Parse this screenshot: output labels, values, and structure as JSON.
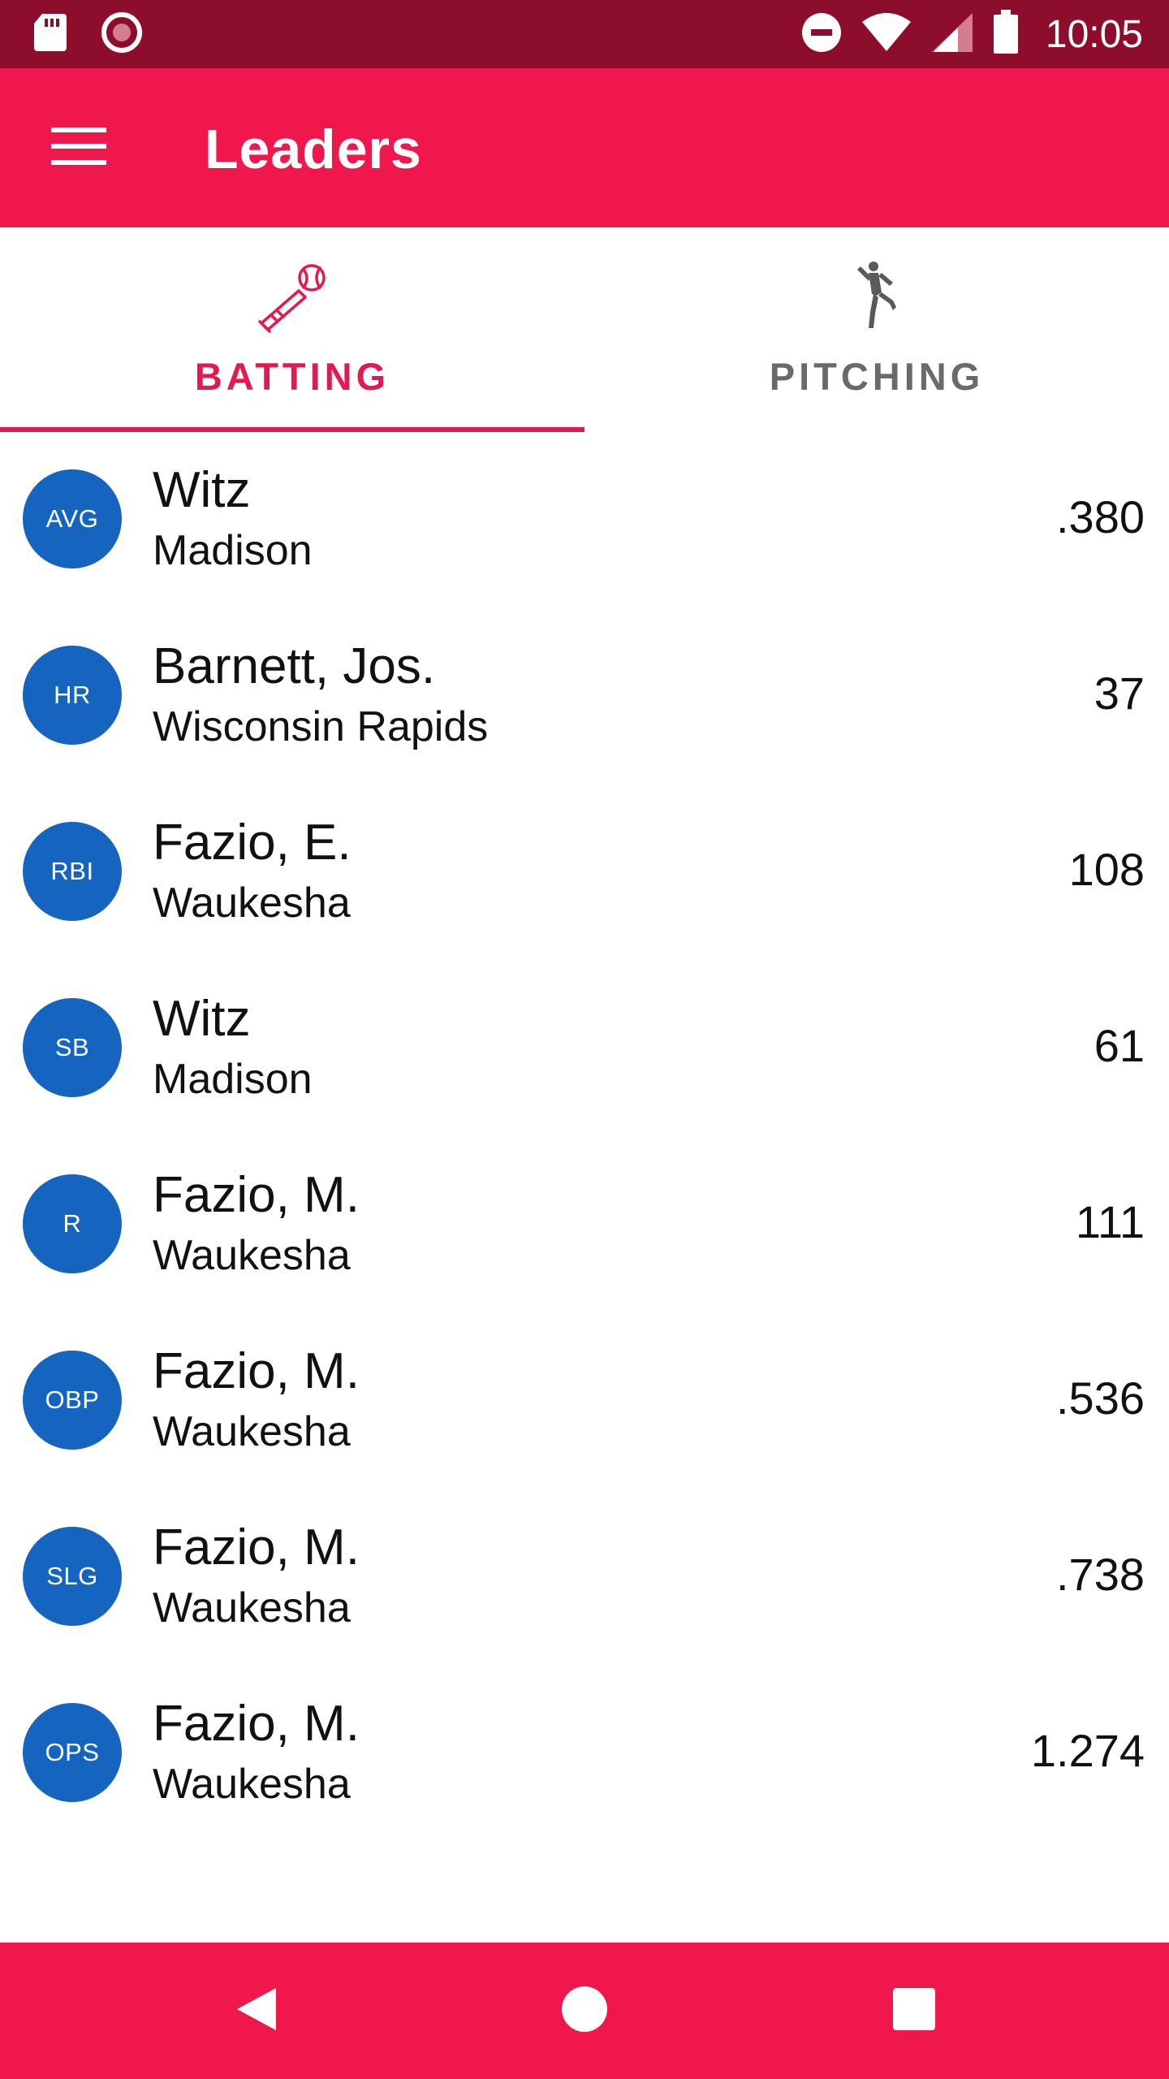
{
  "status_bar": {
    "time": "10:05",
    "icons": [
      "sd-card-icon",
      "record-icon",
      "do-not-disturb-icon",
      "wifi-icon",
      "cell-signal-icon",
      "battery-icon"
    ]
  },
  "app_bar": {
    "menu_icon": "hamburger-menu-icon",
    "title": "Leaders",
    "color": "#ef174c"
  },
  "tabs": [
    {
      "label": "BATTING",
      "icon": "baseball-bat-icon",
      "selected": true
    },
    {
      "label": "PITCHING",
      "icon": "pitcher-icon",
      "selected": false
    }
  ],
  "leaders": [
    {
      "stat": "AVG",
      "player": "Witz",
      "team": "Madison",
      "value": ".380"
    },
    {
      "stat": "HR",
      "player": "Barnett, Jos.",
      "team": "Wisconsin Rapids",
      "value": "37"
    },
    {
      "stat": "RBI",
      "player": "Fazio, E.",
      "team": "Waukesha",
      "value": "108"
    },
    {
      "stat": "SB",
      "player": "Witz",
      "team": "Madison",
      "value": "61"
    },
    {
      "stat": "R",
      "player": "Fazio, M.",
      "team": "Waukesha",
      "value": "111"
    },
    {
      "stat": "OBP",
      "player": "Fazio, M.",
      "team": "Waukesha",
      "value": ".536"
    },
    {
      "stat": "SLG",
      "player": "Fazio, M.",
      "team": "Waukesha",
      "value": ".738"
    },
    {
      "stat": "OPS",
      "player": "Fazio, M.",
      "team": "Waukesha",
      "value": "1.274"
    }
  ],
  "nav_bar": {
    "buttons": [
      "back-icon",
      "home-icon",
      "recents-icon"
    ]
  },
  "colors": {
    "status_bar": "#8c0e2c",
    "accent": "#e21a50",
    "badge": "#1565c0",
    "inactive_tab": "#6a6a6a"
  }
}
